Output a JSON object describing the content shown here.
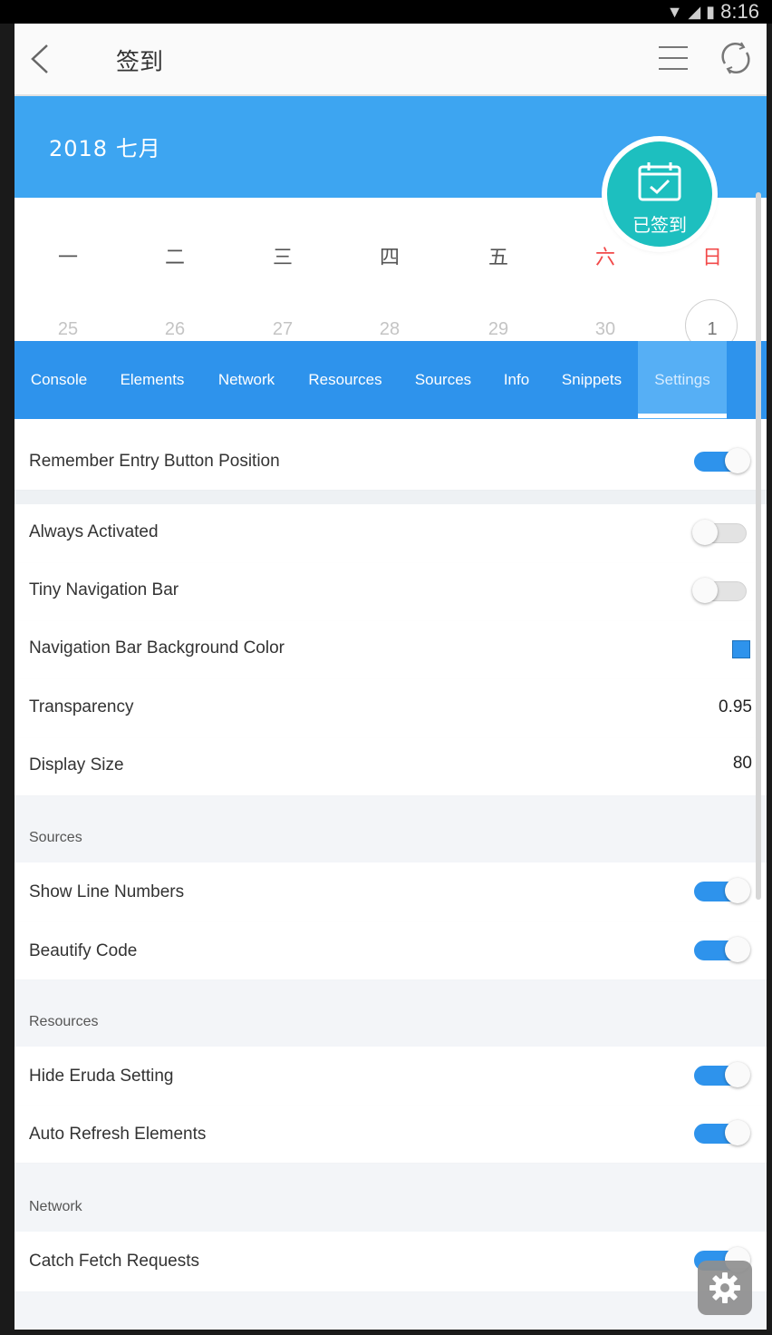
{
  "status_bar": {
    "time": "8:16"
  },
  "app_bar": {
    "title": "签到"
  },
  "calendar": {
    "month_label": "2018  七月",
    "checkin_badge": "已签到",
    "weekdays": [
      "一",
      "二",
      "三",
      "四",
      "五",
      "六",
      "日"
    ],
    "first_row_dates": [
      "25",
      "26",
      "27",
      "28",
      "29",
      "30",
      "1"
    ]
  },
  "eruda": {
    "tabs": [
      "Console",
      "Elements",
      "Network",
      "Resources",
      "Sources",
      "Info",
      "Snippets",
      "Settings"
    ],
    "active_tab": "Settings",
    "settings": {
      "remember_entry": {
        "label": "Remember Entry Button Position",
        "on": true
      },
      "always_activated": {
        "label": "Always Activated",
        "on": false
      },
      "tiny_nav": {
        "label": "Tiny Navigation Bar",
        "on": false
      },
      "nav_bg_color": {
        "label": "Navigation Bar Background Color",
        "color": "#2e93ec"
      },
      "transparency": {
        "label": "Transparency",
        "value": "0.95"
      },
      "display_size": {
        "label": "Display Size",
        "value": "80"
      },
      "sources_header": "Sources",
      "show_line_numbers": {
        "label": "Show Line Numbers",
        "on": true
      },
      "beautify_code": {
        "label": "Beautify Code",
        "on": true
      },
      "resources_header": "Resources",
      "hide_eruda_setting": {
        "label": "Hide Eruda Setting",
        "on": true
      },
      "auto_refresh": {
        "label": "Auto Refresh Elements",
        "on": true
      },
      "network_header": "Network",
      "catch_fetch": {
        "label": "Catch Fetch Requests",
        "on": true
      }
    }
  },
  "colors": {
    "accent": "#2e93ec",
    "calendar_header": "#3da5f1",
    "checkin_badge": "#1dbfbf",
    "weekend": "#f24a4a"
  },
  "icons": {
    "back": "back-icon",
    "menu": "menu-icon",
    "refresh": "refresh-icon",
    "calendar_check": "calendar-check-icon",
    "settings_gear": "gear-icon"
  }
}
